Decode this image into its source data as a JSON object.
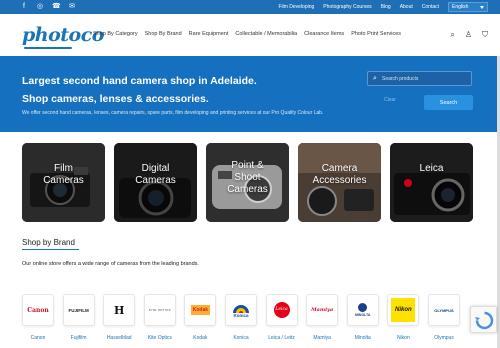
{
  "topbar": {
    "social": [
      "facebook-icon",
      "instagram-icon",
      "phone-icon",
      "email-icon"
    ],
    "links": [
      "Film Developing",
      "Photography Courses",
      "Blog",
      "About",
      "Contact"
    ],
    "language": "English"
  },
  "header": {
    "logo": "photoco",
    "nav": [
      "Shop By Category",
      "Shop By Brand",
      "Rare Equipment",
      "Collectable / Memorabilia",
      "Clearance Items",
      "Photo Print Services"
    ],
    "icons": [
      "search-icon",
      "account-icon",
      "cart-icon"
    ]
  },
  "hero": {
    "headline1": "Largest second hand camera shop in Adelaide.",
    "headline2": "Shop cameras, lenses & accessories.",
    "subtext": "We offer second hand cameras, lenses, camera repairs, spare parts, film developing and printing services at our Pro Quality Colour Lab.",
    "search_placeholder": "Search products",
    "clear_label": "Clear",
    "search_label": "Search"
  },
  "tiles": [
    {
      "label": "Film Cameras",
      "line1": "Film",
      "line2": "Cameras"
    },
    {
      "label": "Digital Cameras",
      "line1": "Digital",
      "line2": "Cameras"
    },
    {
      "label": "Point & Shoot Cameras",
      "line1": "Point &",
      "line2": "Shoot",
      "line3": "Cameras"
    },
    {
      "label": "Camera Accessories",
      "line1": "Camera",
      "line2": "Accessories"
    },
    {
      "label": "Leica",
      "line1": "Leica"
    }
  ],
  "brands_section": {
    "title": "Shop by Brand",
    "description": "Our online store offers a wide range of cameras from the leading brands."
  },
  "brands": [
    {
      "name": "Canon",
      "logo": "Canon",
      "color": "#c8102e"
    },
    {
      "name": "Fujifilm",
      "logo": "FUJIFILM",
      "color": "#222222"
    },
    {
      "name": "Hasselblad",
      "logo": "H",
      "color": "#111111"
    },
    {
      "name": "Kite Optics",
      "logo": "KITE OPTICS",
      "color": "#444444"
    },
    {
      "name": "Kodak",
      "logo": "Kodak",
      "color": "#e31b23"
    },
    {
      "name": "Konica",
      "logo": "Konica",
      "color": "#1a4fa0"
    },
    {
      "name": "Leica / Leitz",
      "logo": "Leica",
      "color": "#e2001a"
    },
    {
      "name": "Mamiya",
      "logo": "Mamiya",
      "color": "#c8102e"
    },
    {
      "name": "Minolta",
      "logo": "MINOLTA",
      "color": "#1d3f8c"
    },
    {
      "name": "Nikon",
      "logo": "Nikon",
      "color": "#111111"
    },
    {
      "name": "Olympus",
      "logo": "OLYMPUS",
      "color": "#0a3a8a"
    }
  ]
}
